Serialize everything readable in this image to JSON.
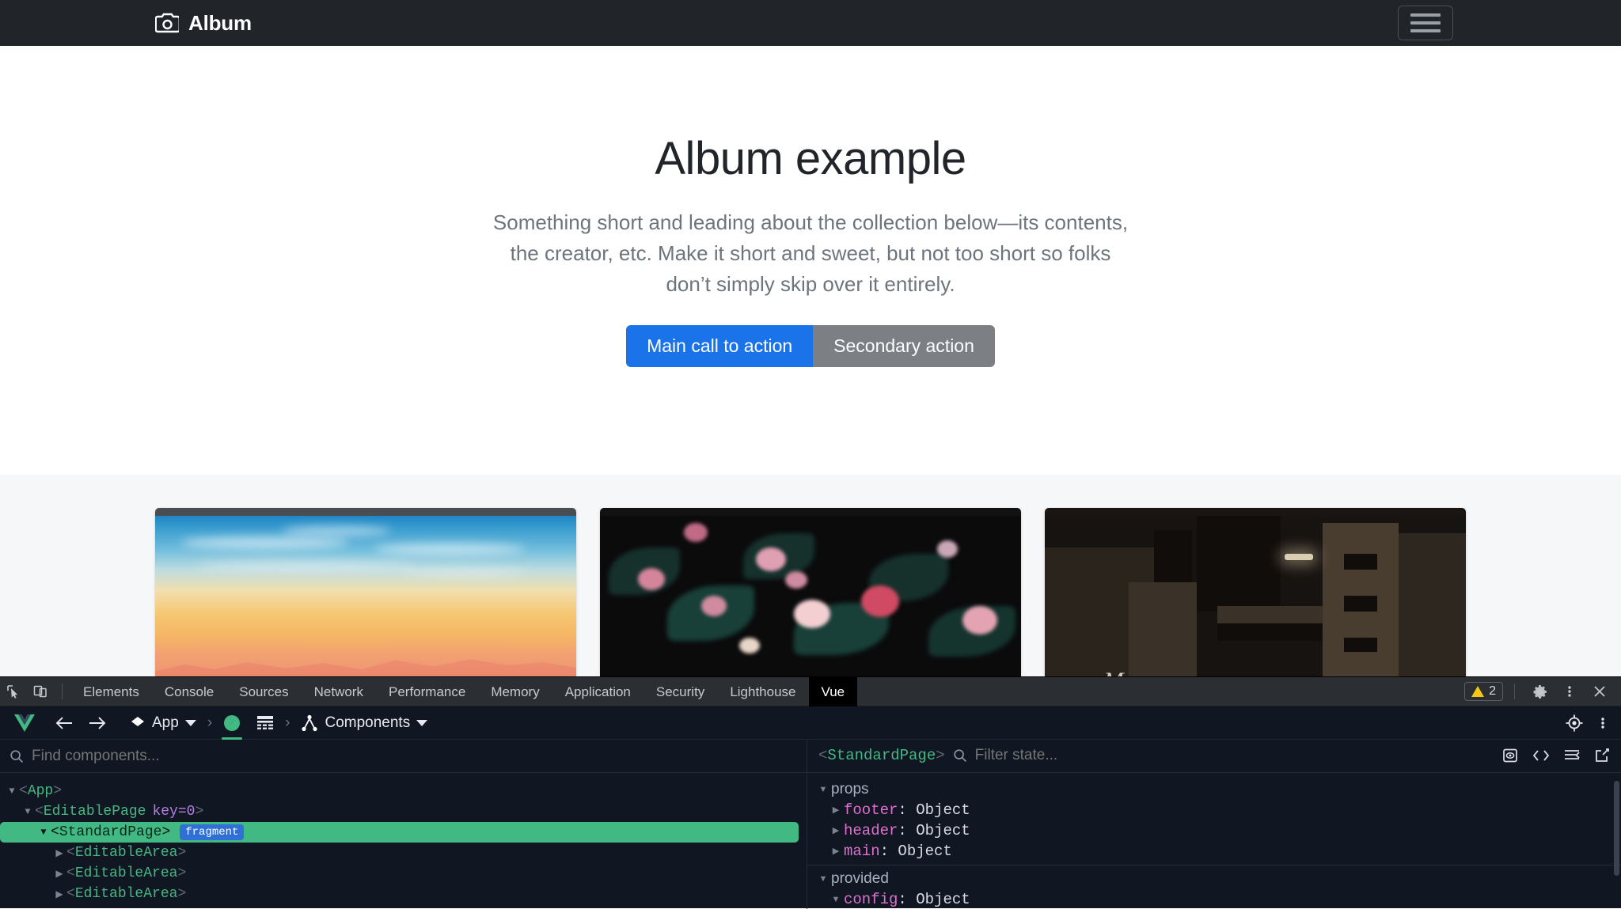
{
  "page": {
    "navbar": {
      "brand": "Album",
      "brand_icon": "camera-icon",
      "menu_icon": "hamburger-icon"
    },
    "hero": {
      "title": "Album example",
      "subtitle": "Something short and leading about the collection below—its contents, the creator, etc. Make it short and sweet, but not too short so folks don’t simply skip over it entirely.",
      "primary_button": "Main call to action",
      "secondary_button": "Secondary action"
    },
    "album": {
      "cards": [
        {
          "image_alt": "sunset sky over mountains"
        },
        {
          "image_alt": "dark pink flowers"
        },
        {
          "image_alt": "night urban buildings with graffiti"
        }
      ]
    }
  },
  "devtools": {
    "left_icons": [
      "inspect-element-icon",
      "device-toolbar-icon"
    ],
    "tabs": [
      {
        "label": "Elements",
        "active": false
      },
      {
        "label": "Console",
        "active": false
      },
      {
        "label": "Sources",
        "active": false
      },
      {
        "label": "Network",
        "active": false
      },
      {
        "label": "Performance",
        "active": false
      },
      {
        "label": "Memory",
        "active": false
      },
      {
        "label": "Application",
        "active": false
      },
      {
        "label": "Security",
        "active": false
      },
      {
        "label": "Lighthouse",
        "active": false
      },
      {
        "label": "Vue",
        "active": true
      }
    ],
    "warnings_count": "2",
    "right_icons": [
      "settings-gear-icon",
      "more-vertical-icon",
      "close-icon"
    ],
    "vue_toolbar": {
      "logo": "vue-logo-icon",
      "back_icon": "arrow-left-icon",
      "forward_icon": "arrow-right-icon",
      "app_label": "App",
      "app_icon": "cube-icon",
      "instance_icon": "vue-instance-icon",
      "grid_icon": "grid-icon",
      "components_label": "Components",
      "components_icon": "component-tree-icon",
      "inspect_icon": "target-icon",
      "more_icon": "more-vertical-icon"
    },
    "tree": {
      "search_placeholder": "Find components...",
      "search_value": "",
      "search_icon": "search-icon",
      "nodes": [
        {
          "depth": 0,
          "arrow": "open",
          "name": "App",
          "attr": "",
          "badge": "",
          "selected": false
        },
        {
          "depth": 1,
          "arrow": "open",
          "name": "EditablePage",
          "attr": "key=0",
          "badge": "",
          "selected": false
        },
        {
          "depth": 2,
          "arrow": "open",
          "name": "StandardPage",
          "attr": "",
          "badge": "fragment",
          "selected": true
        },
        {
          "depth": 3,
          "arrow": "closed",
          "name": "EditableArea",
          "attr": "",
          "badge": "",
          "selected": false
        },
        {
          "depth": 3,
          "arrow": "closed",
          "name": "EditableArea",
          "attr": "",
          "badge": "",
          "selected": false
        },
        {
          "depth": 3,
          "arrow": "closed",
          "name": "EditableArea",
          "attr": "",
          "badge": "",
          "selected": false
        }
      ]
    },
    "state": {
      "component": "StandardPage",
      "filter_placeholder": "Filter state...",
      "filter_value": "",
      "search_icon": "search-icon",
      "toolbar_icons": [
        "inspect-dom-icon",
        "open-in-editor-code-icon",
        "collapse-all-icon",
        "open-external-icon"
      ],
      "groups": [
        {
          "name": "props",
          "open": true,
          "rows": [
            {
              "arrow": "closed",
              "key": "footer",
              "value": "Object"
            },
            {
              "arrow": "closed",
              "key": "header",
              "value": "Object"
            },
            {
              "arrow": "closed",
              "key": "main",
              "value": "Object"
            }
          ]
        },
        {
          "name": "provided",
          "open": true,
          "rows": [
            {
              "arrow": "open",
              "key": "config",
              "value": "Object"
            }
          ]
        }
      ]
    }
  },
  "colors": {
    "brand_dark": "#212529",
    "primary_blue": "#1a73e8",
    "secondary_gray": "#7c7f83",
    "vue_green": "#42b883",
    "devtools_bg": "#111722",
    "tab_bar_bg": "#2b2f33",
    "warning_yellow": "#f5c518"
  }
}
